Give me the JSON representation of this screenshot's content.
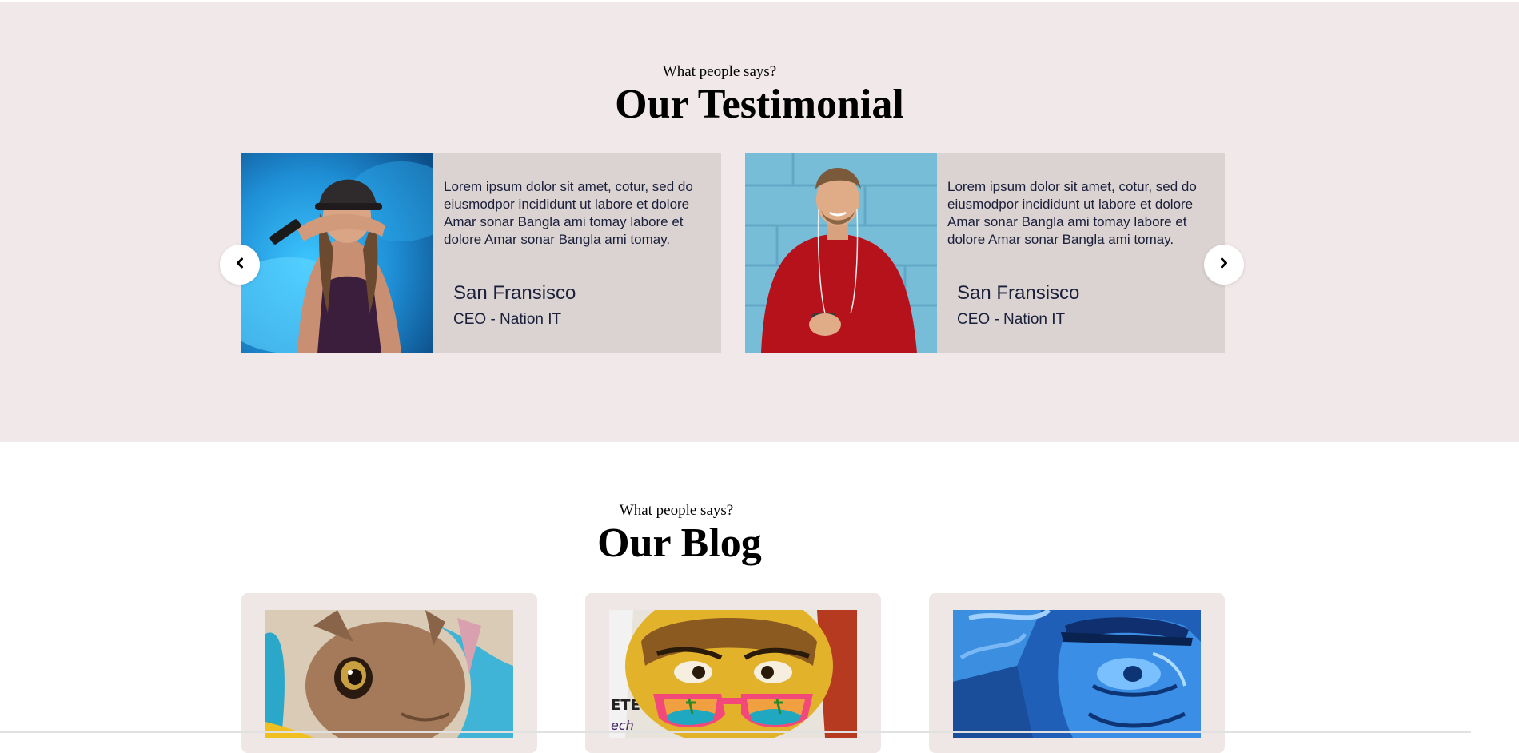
{
  "testimonial": {
    "kicker": "What people says?",
    "title": "Our Testimonial",
    "cards": [
      {
        "quote": "Lorem ipsum dolor sit amet, cotur, sed do eiusmodpor incididunt ut labore et dolore Amar sonar Bangla ami tomay labore et dolore Amar sonar Bangla ami tomay.",
        "name": "San Fransisco",
        "role": "CEO - Nation IT"
      },
      {
        "quote": "Lorem ipsum dolor sit amet, cotur, sed do eiusmodpor incididunt ut labore et dolore Amar sonar Bangla ami tomay labore et dolore Amar sonar Bangla ami tomay.",
        "name": "San Fransisco",
        "role": "CEO - Nation IT"
      }
    ],
    "prev_icon": "chevron-left-icon",
    "next_icon": "chevron-right-icon"
  },
  "blog": {
    "kicker": "What people says?",
    "title": "Our Blog"
  },
  "colors": {
    "testimonial_bg": "#f1e8e9",
    "card_bg": "#dbd2d2",
    "blog_card_bg": "#efe6e6",
    "text": "#1a1f3a"
  }
}
